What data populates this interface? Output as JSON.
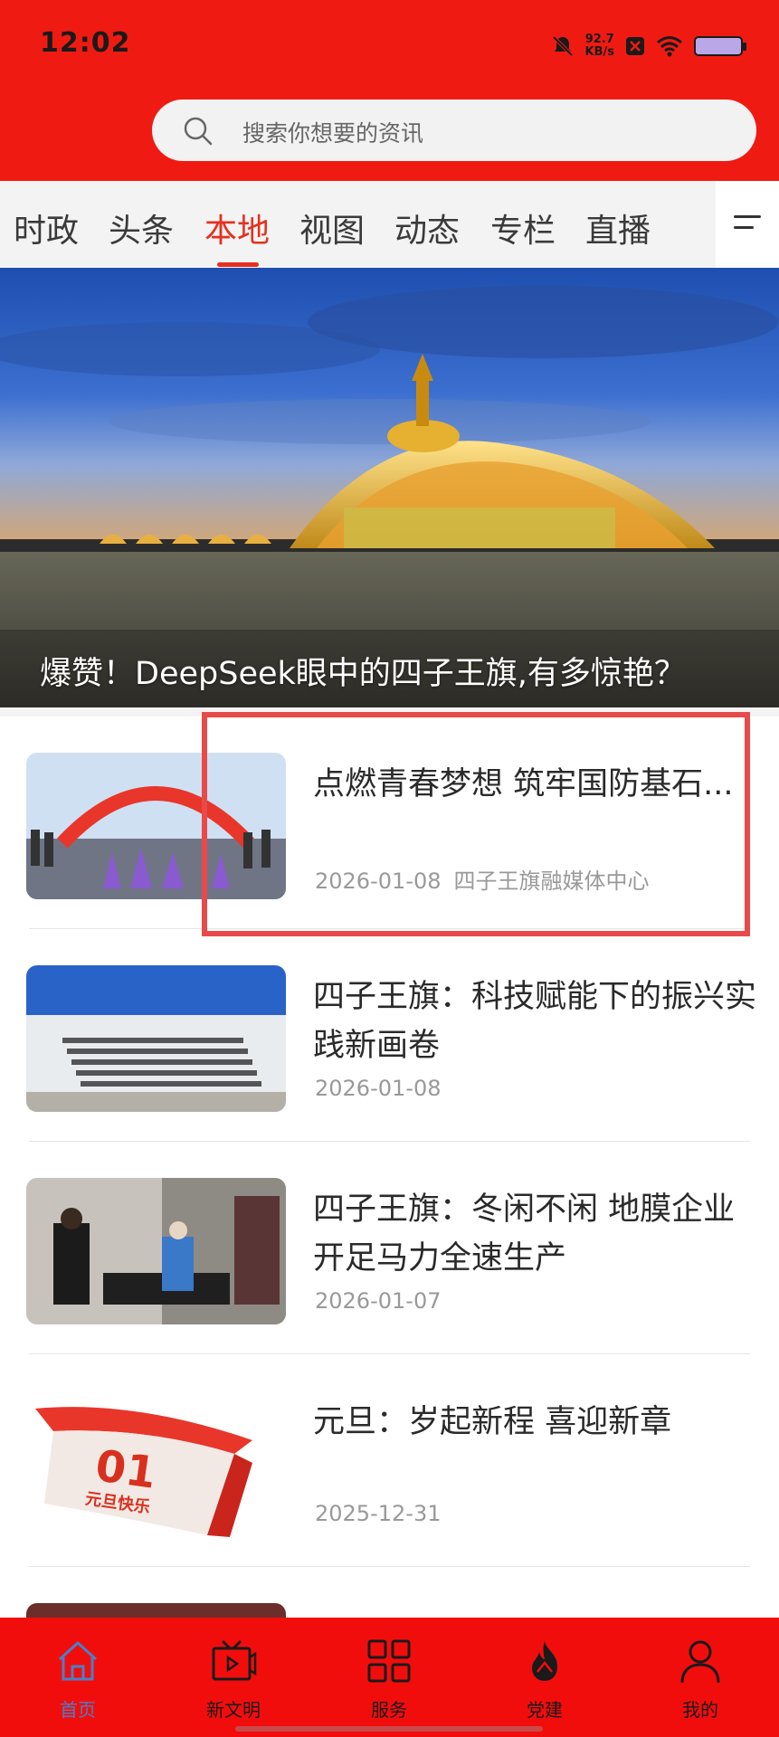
{
  "status_bar": {
    "time": "12:02",
    "net_speed_value": "92.7",
    "net_speed_unit": "KB/s",
    "icons": [
      "mute-icon",
      "x-box-icon",
      "wifi-icon",
      "battery-icon"
    ]
  },
  "search": {
    "placeholder": "搜索你想要的资讯"
  },
  "tabs": [
    {
      "label": "时政"
    },
    {
      "label": "头条"
    },
    {
      "label": "本地",
      "active": true
    },
    {
      "label": "视图"
    },
    {
      "label": "动态"
    },
    {
      "label": "专栏"
    },
    {
      "label": "直播"
    }
  ],
  "banner": {
    "caption": "爆赞！DeepSeek眼中的四子王旗,有多惊艳？"
  },
  "news": [
    {
      "title": "点燃青春梦想  筑牢国防基石...",
      "date": "2026-01-08",
      "source": "四子王旗融媒体中心"
    },
    {
      "title": "四子王旗：科技赋能下的振兴实践新画卷",
      "date": "2026-01-08",
      "source": ""
    },
    {
      "title": "四子王旗：冬闲不闲  地膜企业开足马力全速生产",
      "date": "2026-01-07",
      "source": ""
    },
    {
      "title": "元旦：岁起新程  喜迎新章",
      "date": "2025-12-31",
      "source": ""
    }
  ],
  "calendar_thumb": {
    "number": "01",
    "text": "元旦快乐"
  },
  "bottom_nav": [
    {
      "label": "首页",
      "icon": "home-icon",
      "active": true
    },
    {
      "label": "新文明",
      "icon": "tv-icon"
    },
    {
      "label": "服务",
      "icon": "grid-icon"
    },
    {
      "label": "党建",
      "icon": "flame-icon"
    },
    {
      "label": "我的",
      "icon": "person-icon"
    }
  ],
  "colors": {
    "brand_red": "#ef1b12",
    "active_tab": "#e5301f",
    "active_nav": "#4a7fc9",
    "highlight": "#e84a4a"
  }
}
